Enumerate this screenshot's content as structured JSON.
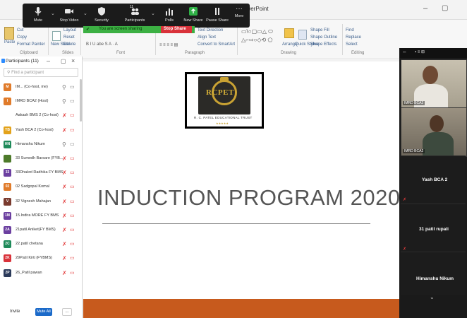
{
  "powerpoint": {
    "title": "owerPoint",
    "ribbon": {
      "clipboard": {
        "cut": "Cut",
        "copy": "Copy",
        "format_painter": "Format Painter",
        "paste": "Paste",
        "label": "Clipboard"
      },
      "slides": {
        "layout": "Layout",
        "reset": "Reset",
        "delete": "Delete",
        "new_slide": "New Slide",
        "label": "Slides"
      },
      "font_label": "Font",
      "paragraph": {
        "text_direction": "Text Direction",
        "align_text": "Align Text",
        "convert": "Convert to SmartArt",
        "label": "Paragraph"
      },
      "drawing": {
        "arrange": "Arrange",
        "quick_styles": "Quick Styles",
        "shape_fill": "Shape Fill",
        "shape_outline": "Shape Outline",
        "shape_effects": "Shape Effects",
        "label": "Drawing"
      },
      "editing": {
        "find": "Find",
        "replace": "Replace",
        "select": "Select",
        "label": "Editing"
      }
    }
  },
  "zoom": {
    "toolbar": {
      "mute": "Mute",
      "stop_video": "Stop Video",
      "security": "Security",
      "participants": "Participants",
      "participants_count": "11",
      "polls": "Polls",
      "new_share": "New Share",
      "pause_share": "Pause Share",
      "more": "More"
    },
    "sharing_notice": "You are screen sharing",
    "stop_share": "Stop Share"
  },
  "participants_panel": {
    "title": "Participants (11)",
    "search_placeholder": "Find a participant",
    "rows": [
      {
        "initials": "M",
        "name": "IM... (Co-host, me)",
        "color": "#e07b2a",
        "muted": false
      },
      {
        "initials": "I",
        "name": "IMRD BCA2 (Host)",
        "color": "#e07b2a",
        "muted": false
      },
      {
        "initials": "",
        "name": "Aakash BMS 2 (Co-host)",
        "color": "",
        "muted": true
      },
      {
        "initials": "YB",
        "name": "Yash BCA 2 (Co-host)",
        "color": "#e3a21a",
        "muted": true
      },
      {
        "initials": "HN",
        "name": "Himanshu Nikum",
        "color": "#1f8a5a",
        "muted": false
      },
      {
        "initials": "",
        "name": "33 Sumedh Barsare (FYB...",
        "color": "#4d7a2a",
        "muted": true
      },
      {
        "initials": "33",
        "name": "33Dhakrd Radhika FY BMS",
        "color": "#6b3fa0",
        "muted": true
      },
      {
        "initials": "02",
        "name": "02 Sadgopal Komal",
        "color": "#e07b2a",
        "muted": true
      },
      {
        "initials": "V",
        "name": "32 Vignesh Mahajan",
        "color": "#7a3b2e",
        "muted": true
      },
      {
        "initials": "1M",
        "name": "15.Indira MORE FY BMS",
        "color": "#6b3fa0",
        "muted": true
      },
      {
        "initials": "2A",
        "name": "21patil Aniket(FY BMS)",
        "color": "#6b3fa0",
        "muted": true
      },
      {
        "initials": "2C",
        "name": "22.patil chetana",
        "color": "#1f8a5a",
        "muted": true
      },
      {
        "initials": "2K",
        "name": "29Patil Kirti (FYBMS)",
        "color": "#d9323a",
        "muted": true
      },
      {
        "initials": "2P",
        "name": "26_Patil pawan",
        "color": "#2b3a5a",
        "muted": true
      }
    ],
    "invite": "Invite",
    "mute_all": "Mute All",
    "more": "..."
  },
  "slide": {
    "logo_text": "RCPET",
    "logo_subtitle": "R. C. PATEL EDUCATIONAL TRUST",
    "logo_stars": "★★★★★",
    "title": "INDUCTION PROGRAM 2020"
  },
  "gallery": {
    "videos": [
      {
        "label": "IMRD BCA2"
      },
      {
        "label": "IMRD BCA2"
      }
    ],
    "tiles": [
      {
        "name": "Yash BCA 2"
      },
      {
        "name": "31 patil rupali"
      },
      {
        "name": "Himanshu Nikum"
      }
    ]
  }
}
